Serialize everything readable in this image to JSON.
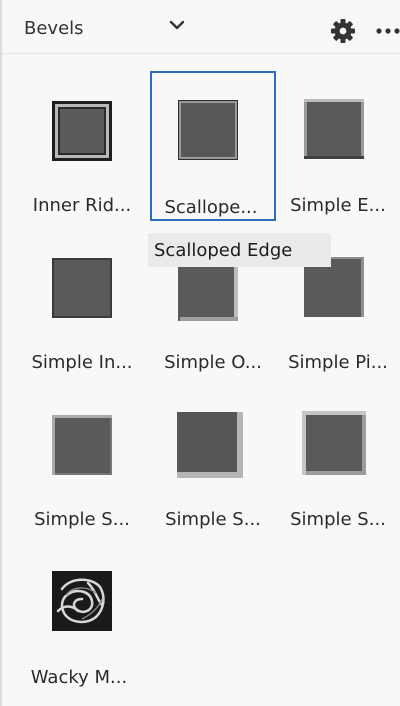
{
  "header": {
    "dropdown_label": "Bevels",
    "icons": [
      "chevron-down-icon",
      "gear-icon",
      "more-icon"
    ]
  },
  "tooltip": "Scalloped Edge",
  "colors": {
    "selection": "#2d6fbd",
    "thumb_fill": "#585858"
  },
  "items": [
    {
      "label": "Inner Rid...",
      "selected": false
    },
    {
      "label": "Scallope...",
      "selected": true
    },
    {
      "label": "Simple E...",
      "selected": false
    },
    {
      "label": "Simple In...",
      "selected": false
    },
    {
      "label": "Simple O...",
      "selected": false
    },
    {
      "label": "Simple Pi...",
      "selected": false
    },
    {
      "label": "Simple S...",
      "selected": false
    },
    {
      "label": "Simple S...",
      "selected": false
    },
    {
      "label": "Simple S...",
      "selected": false
    },
    {
      "label": "Wacky M...",
      "selected": false
    }
  ]
}
